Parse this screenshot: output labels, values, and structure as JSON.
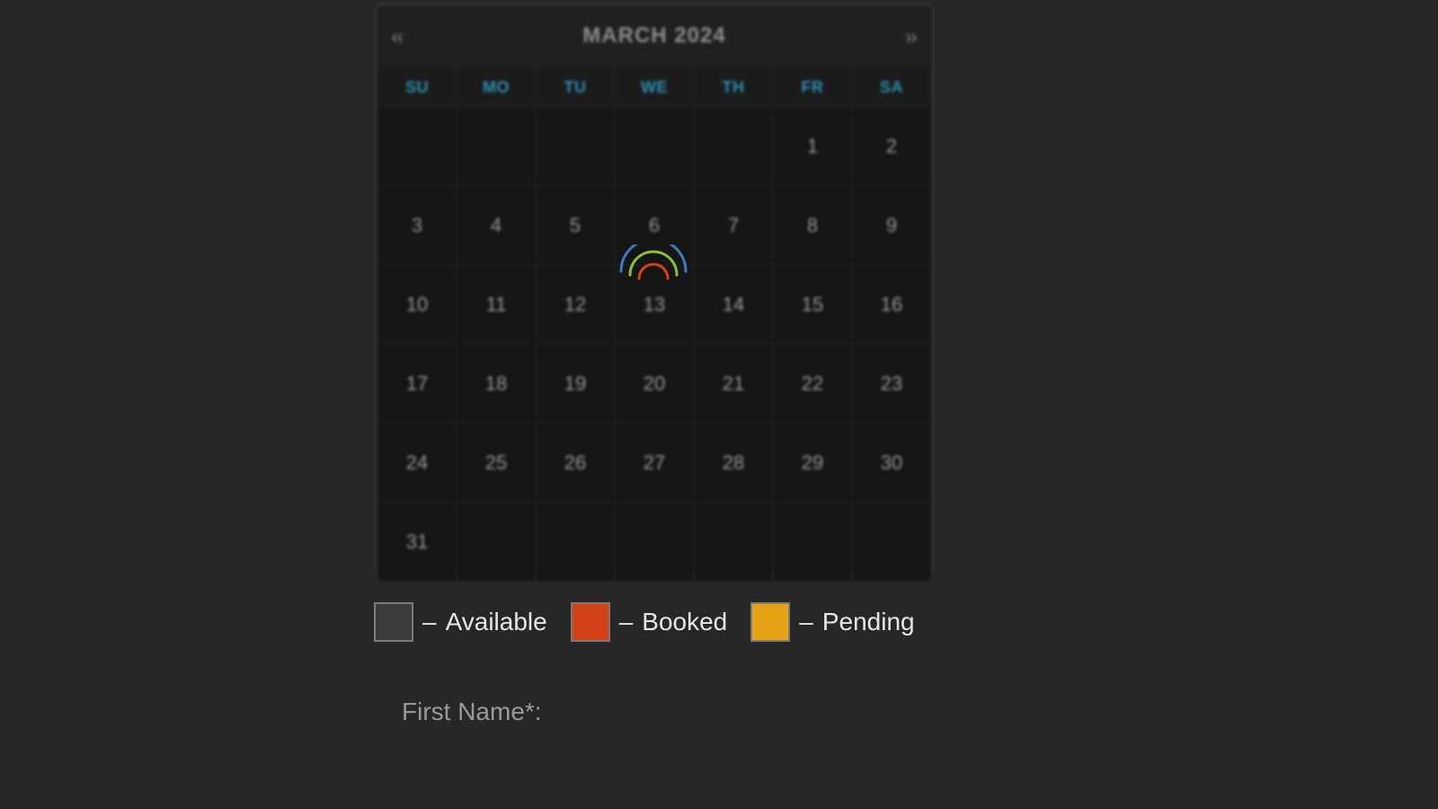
{
  "calendar": {
    "title": "MARCH 2024",
    "prev_glyph": "«",
    "next_glyph": "»",
    "weekdays": [
      "SU",
      "MO",
      "TU",
      "WE",
      "TH",
      "FR",
      "SA"
    ],
    "rows": [
      [
        "",
        "",
        "",
        "",
        "",
        "1",
        "2"
      ],
      [
        "3",
        "4",
        "5",
        "6",
        "7",
        "8",
        "9"
      ],
      [
        "10",
        "11",
        "12",
        "13",
        "14",
        "15",
        "16"
      ],
      [
        "17",
        "18",
        "19",
        "20",
        "21",
        "22",
        "23"
      ],
      [
        "24",
        "25",
        "26",
        "27",
        "28",
        "29",
        "30"
      ],
      [
        "31",
        "",
        "",
        "",
        "",
        "",
        ""
      ]
    ],
    "loading": true
  },
  "legend": {
    "items": [
      {
        "label": "Available",
        "color": "#3c3c3c"
      },
      {
        "label": "Booked",
        "color": "#d44218"
      },
      {
        "label": "Pending",
        "color": "#e6a318"
      }
    ],
    "sep": "–"
  },
  "form": {
    "first_name_label": "First Name*:"
  },
  "spinner": {
    "colors": [
      "#3b7bbf",
      "#8bbf3b",
      "#d44218"
    ]
  }
}
